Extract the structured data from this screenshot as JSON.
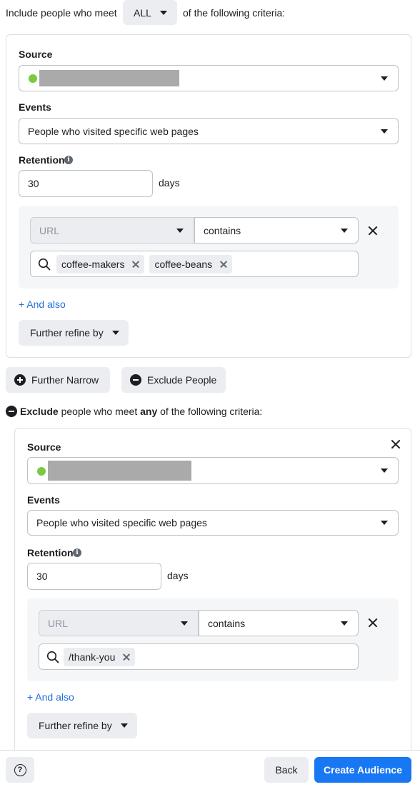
{
  "include": {
    "prefix": "Include people who meet",
    "match_value": "ALL",
    "suffix": "of the following criteria:",
    "source_label": "Source",
    "events_label": "Events",
    "events_value": "People who visited specific web pages",
    "retention_label": "Retention",
    "retention_value": "30",
    "retention_unit": "days",
    "url_field": "URL",
    "operator": "contains",
    "tags": [
      "coffee-makers",
      "coffee-beans"
    ],
    "and_also": "+ And also",
    "further_refine": "Further refine by"
  },
  "actions": {
    "further_narrow": "Further Narrow",
    "exclude_people": "Exclude People"
  },
  "exclude": {
    "keyword": "Exclude",
    "middle": "people who meet",
    "any": "any",
    "suffix": "of the following criteria:",
    "source_label": "Source",
    "events_label": "Events",
    "events_value": "People who visited specific web pages",
    "retention_label": "Retention",
    "retention_value": "30",
    "retention_unit": "days",
    "url_field": "URL",
    "operator": "contains",
    "tags": [
      "/thank-you"
    ],
    "and_also": "+ And also",
    "further_refine": "Further refine by"
  },
  "footer": {
    "help": "?",
    "back": "Back",
    "create": "Create Audience"
  }
}
